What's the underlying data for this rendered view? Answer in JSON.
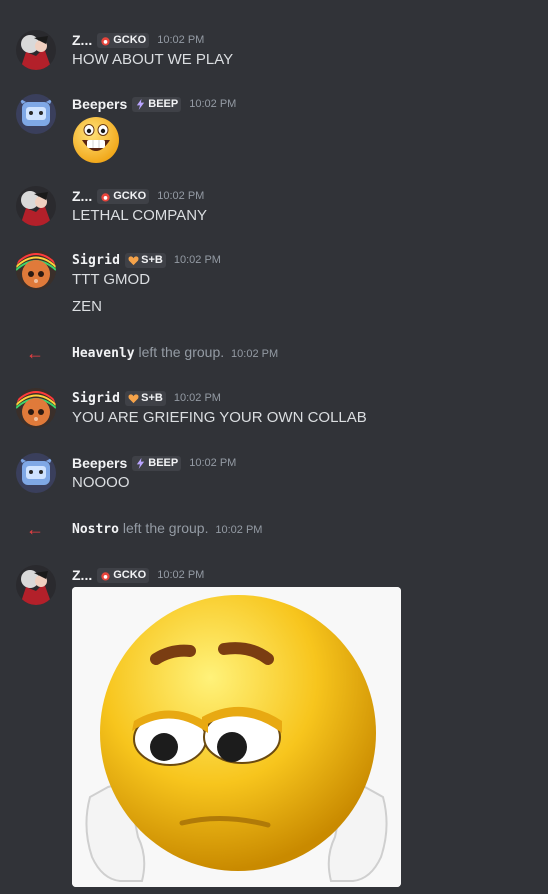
{
  "tags": {
    "gcko": "GCKO",
    "beep": "BEEP",
    "sb": "S+B"
  },
  "colors": {
    "background": "#313338",
    "leave_arrow": "#f23f43",
    "timestamp": "#949ba4",
    "emoji_yellow": "#f7c51d"
  },
  "messages": [
    {
      "author": "Z...",
      "tag": "GCKO",
      "time": "10:02 PM",
      "lines": [
        "HOW ABOUT WE PLAY"
      ]
    },
    {
      "author": "Beepers",
      "tag": "BEEP",
      "time": "10:02 PM",
      "emoji": "grinning-emoji"
    },
    {
      "author": "Z...",
      "tag": "GCKO",
      "time": "10:02 PM",
      "lines": [
        "LETHAL COMPANY"
      ]
    },
    {
      "author": "Sigrid",
      "tag": "S+B",
      "time": "10:02 PM",
      "lines": [
        "TTT GMOD",
        "ZEN"
      ]
    },
    {
      "system": true,
      "who": "Heavenly",
      "action": "left the group.",
      "time": "10:02 PM"
    },
    {
      "author": "Sigrid",
      "tag": "S+B",
      "time": "10:02 PM",
      "lines": [
        "YOU ARE GRIEFING YOUR OWN COLLAB"
      ]
    },
    {
      "author": "Beepers",
      "tag": "BEEP",
      "time": "10:02 PM",
      "lines": [
        "NOOOO"
      ]
    },
    {
      "system": true,
      "who": "Nostro",
      "action": "left the group.",
      "time": "10:02 PM"
    },
    {
      "author": "Z...",
      "tag": "GCKO",
      "time": "10:02 PM",
      "attachment": "sad-emoji-image"
    }
  ]
}
